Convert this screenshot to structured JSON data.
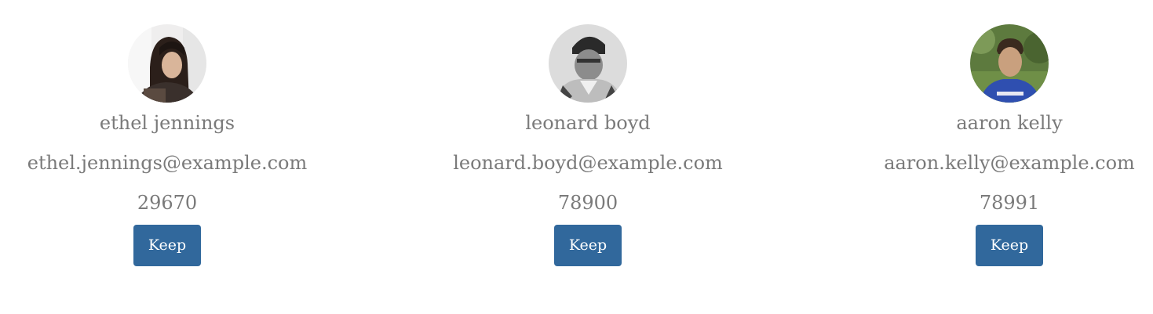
{
  "users": [
    {
      "name": "ethel jennings",
      "email": "ethel.jennings@example.com",
      "number": "29670",
      "button_label": "Keep"
    },
    {
      "name": "leonard boyd",
      "email": "leonard.boyd@example.com",
      "number": "78900",
      "button_label": "Keep"
    },
    {
      "name": "aaron kelly",
      "email": "aaron.kelly@example.com",
      "number": "78991",
      "button_label": "Keep"
    }
  ],
  "colors": {
    "button_bg": "#31689c",
    "text": "#7a7a7a"
  }
}
